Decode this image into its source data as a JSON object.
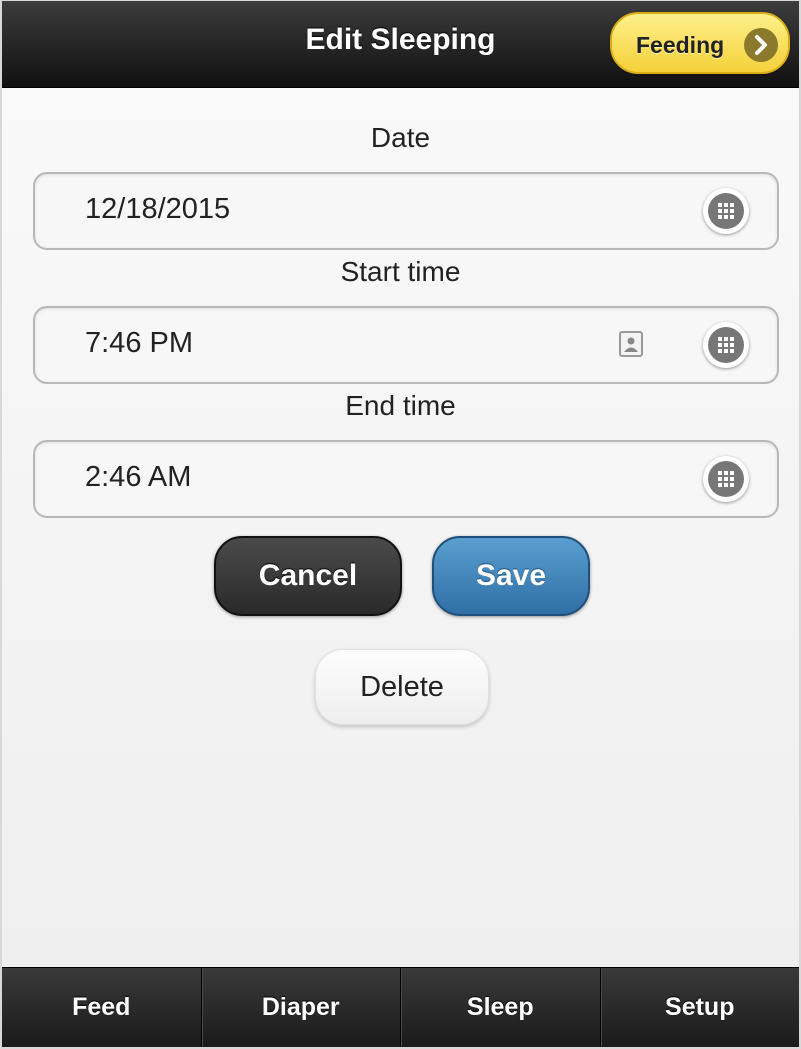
{
  "header": {
    "title": "Edit Sleeping",
    "feeding_button": "Feeding"
  },
  "form": {
    "date_label": "Date",
    "date_value": "12/18/2015",
    "start_label": "Start time",
    "start_value": "7:46 PM",
    "end_label": "End time",
    "end_value": "2:46 AM"
  },
  "actions": {
    "cancel": "Cancel",
    "save": "Save",
    "delete": "Delete"
  },
  "nav": {
    "items": [
      "Feed",
      "Diaper",
      "Sleep",
      "Setup"
    ]
  },
  "colors": {
    "feeding_button": "#f5d13a",
    "save_button": "#3a7db5",
    "cancel_button": "#333333"
  },
  "icons": {
    "feeding_button": "chevron-right-icon",
    "picker": "grid-icon",
    "start_time_extra": "contact-card-icon"
  }
}
